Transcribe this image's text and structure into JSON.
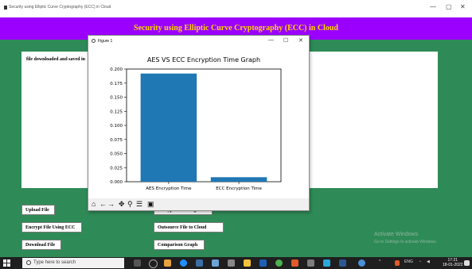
{
  "window": {
    "title": "Security using Elliptic Curve Cryptography (ECC) in Cloud",
    "minimize": "—",
    "maximize": "▢",
    "close": "✕"
  },
  "banner": {
    "text": "Security using Elliptic Curve Cryptography (ECC) in Cloud"
  },
  "status": {
    "text": "file downloaded and saved in"
  },
  "buttons": {
    "upload": "Upload File",
    "encrypt_ecc": "Encrypt File Using ECC",
    "download": "Download File",
    "encrypt_aes": "Encrypt File Using AES",
    "outsource": "Outsource File to Cloud",
    "comparison": "Comparison Graph"
  },
  "watermark": {
    "line1": "Activate Windows",
    "line2": "Go to Settings to activate Windows."
  },
  "figure": {
    "title": "Figure 1",
    "minimize": "—",
    "maximize": "☐",
    "close": "✕"
  },
  "chart_data": {
    "type": "bar",
    "title": "AES VS ECC Encryption Time Graph",
    "categories": [
      "AES Encryption Time",
      "ECC Encryption Time"
    ],
    "values": [
      0.192,
      0.008
    ],
    "ylim": [
      0,
      0.2
    ],
    "yticks": [
      "0.000",
      "0.025",
      "0.050",
      "0.075",
      "0.100",
      "0.125",
      "0.150",
      "0.175",
      "0.200"
    ],
    "color": "#1f77b4",
    "grid": false
  },
  "toolbar": {
    "home": "⌂",
    "back": "←",
    "forward": "→",
    "pan": "✥",
    "zoom": "⚲",
    "configure": "☰",
    "save": "▣"
  },
  "taskbar": {
    "search_placeholder": "Type here to search",
    "time": "17:21",
    "date": "18-01-2022",
    "tray_text": "ENG"
  }
}
